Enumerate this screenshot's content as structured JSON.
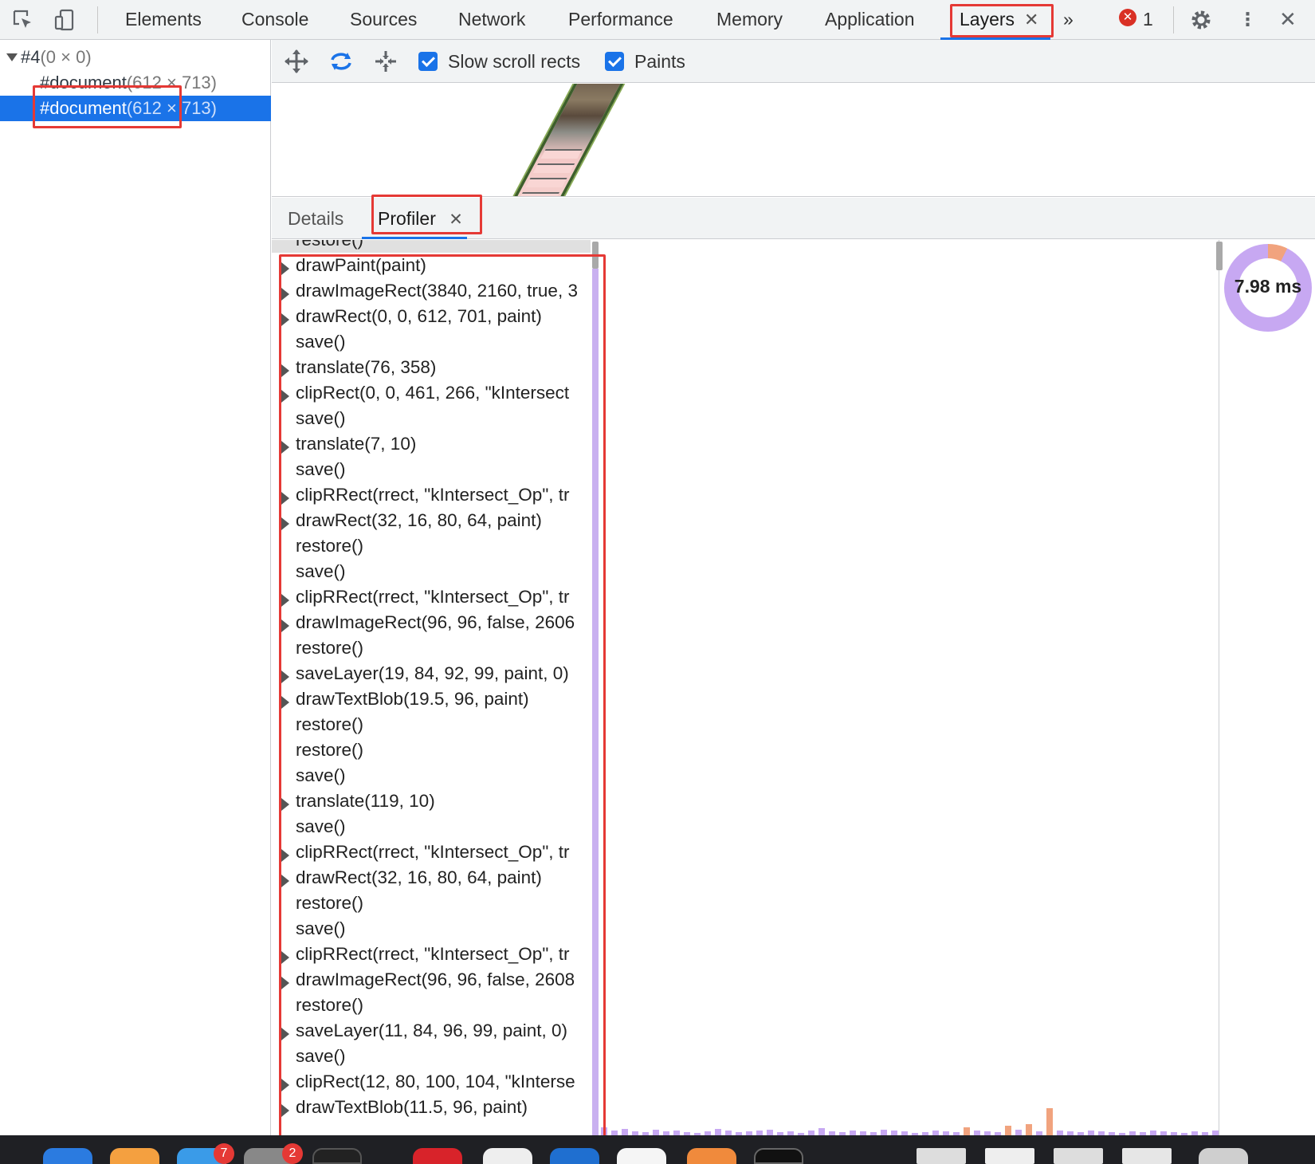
{
  "toolbar": {
    "tabs": [
      {
        "label": "Elements"
      },
      {
        "label": "Console"
      },
      {
        "label": "Sources"
      },
      {
        "label": "Network"
      },
      {
        "label": "Performance"
      },
      {
        "label": "Memory"
      },
      {
        "label": "Application"
      },
      {
        "label": "Layers",
        "active": true,
        "close": "✕"
      }
    ],
    "more_label": "»",
    "error_count": "1",
    "error_icon_glyph": "✕",
    "menu_glyph": "⋮",
    "close_glyph": "✕"
  },
  "layer_tree": {
    "root": {
      "name": "#4",
      "size": "(0 × 0)"
    },
    "items": [
      {
        "name": "#document",
        "size": "(612 × 713)",
        "selected": false
      },
      {
        "name": "#document",
        "size": "(612 × 713)",
        "selected": true
      }
    ]
  },
  "layer_toolbar": {
    "options": [
      {
        "label": "Slow scroll rects",
        "checked": true
      },
      {
        "label": "Paints",
        "checked": true
      }
    ]
  },
  "bottom_tabs": [
    {
      "label": "Details"
    },
    {
      "label": "Profiler",
      "active": true,
      "close": "✕"
    }
  ],
  "profiler": {
    "paint_time": "7.98 ms",
    "log": [
      {
        "text": "restore()",
        "expandable": false
      },
      {
        "text": "drawPaint(paint)",
        "expandable": true
      },
      {
        "text": "drawImageRect(3840, 2160, true, 3",
        "expandable": true
      },
      {
        "text": "drawRect(0, 0, 612, 701, paint)",
        "expandable": true
      },
      {
        "text": "save()",
        "expandable": false
      },
      {
        "text": "translate(76, 358)",
        "expandable": true
      },
      {
        "text": "clipRect(0, 0, 461, 266, \"kIntersect",
        "expandable": true
      },
      {
        "text": "save()",
        "expandable": false
      },
      {
        "text": "translate(7, 10)",
        "expandable": true
      },
      {
        "text": "save()",
        "expandable": false
      },
      {
        "text": "clipRRect(rrect, \"kIntersect_Op\", tr",
        "expandable": true
      },
      {
        "text": "drawRect(32, 16, 80, 64, paint)",
        "expandable": true
      },
      {
        "text": "restore()",
        "expandable": false
      },
      {
        "text": "save()",
        "expandable": false
      },
      {
        "text": "clipRRect(rrect, \"kIntersect_Op\", tr",
        "expandable": true
      },
      {
        "text": "drawImageRect(96, 96, false, 2606",
        "expandable": true
      },
      {
        "text": "restore()",
        "expandable": false
      },
      {
        "text": "saveLayer(19, 84, 92, 99, paint, 0)",
        "expandable": true
      },
      {
        "text": "drawTextBlob(19.5, 96, paint)",
        "expandable": true
      },
      {
        "text": "restore()",
        "expandable": false
      },
      {
        "text": "restore()",
        "expandable": false
      },
      {
        "text": "save()",
        "expandable": false
      },
      {
        "text": "translate(119, 10)",
        "expandable": true
      },
      {
        "text": "save()",
        "expandable": false
      },
      {
        "text": "clipRRect(rrect, \"kIntersect_Op\", tr",
        "expandable": true
      },
      {
        "text": "drawRect(32, 16, 80, 64, paint)",
        "expandable": true
      },
      {
        "text": "restore()",
        "expandable": false
      },
      {
        "text": "save()",
        "expandable": false
      },
      {
        "text": "clipRRect(rrect, \"kIntersect_Op\", tr",
        "expandable": true
      },
      {
        "text": "drawImageRect(96, 96, false, 2608",
        "expandable": true
      },
      {
        "text": "restore()",
        "expandable": false
      },
      {
        "text": "saveLayer(11, 84, 96, 99, paint, 0)",
        "expandable": true
      },
      {
        "text": "save()",
        "expandable": false
      },
      {
        "text": "clipRect(12, 80, 100, 104, \"kInterse",
        "expandable": true
      },
      {
        "text": "drawTextBlob(11.5, 96, paint)",
        "expandable": true
      }
    ]
  },
  "dock": {
    "badges": [
      "7",
      "2"
    ]
  },
  "colors": {
    "accent": "#1a73e8",
    "annotation": "#e53935",
    "timeline_purple": "#c7a8f2",
    "timeline_orange": "#f1a37e"
  }
}
